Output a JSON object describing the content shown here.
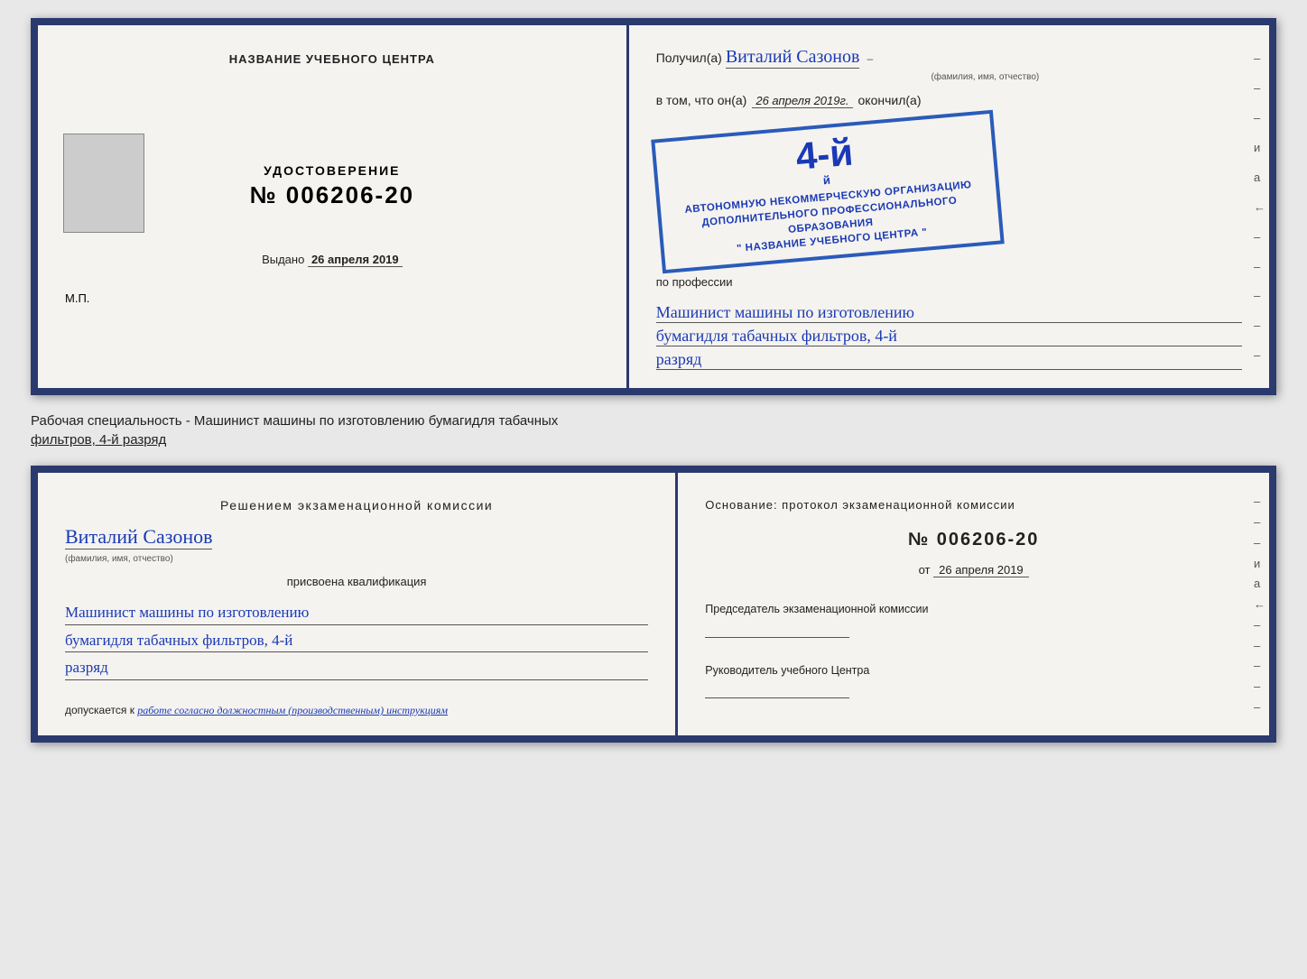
{
  "top_document": {
    "left": {
      "center_title": "НАЗВАНИЕ УЧЕБНОГО ЦЕНТРА",
      "photo_alt": "photo",
      "udostoverenie_title": "УДОСТОВЕРЕНИЕ",
      "udostoverenie_number": "№ 006206-20",
      "vydano_label": "Выдано",
      "vydano_date": "26 апреля 2019",
      "mp_label": "М.П."
    },
    "right": {
      "poluchil_prefix": "Получил(а)",
      "recipient_name": "Виталий Сазонов",
      "fio_label": "(фамилия, имя, отчество)",
      "vtom_prefix": "в том, что он(а)",
      "date": "26 апреля 2019г.",
      "okonchil": "окончил(а)",
      "stamp_number": "4-й",
      "stamp_line1": "АВТОНОМНУЮ НЕКОММЕРЧЕСКУЮ ОРГАНИЗАЦИЮ",
      "stamp_line2": "ДОПОЛНИТЕЛЬНОГО ПРОФЕССИОНАЛЬНОГО ОБРАЗОВАНИЯ",
      "stamp_line3": "\" НАЗВАНИЕ УЧЕБНОГО ЦЕНТРА \"",
      "po_professii": "по профессии",
      "profession_line1": "Машинист машины по изготовлению",
      "profession_line2": "бумагидля табачных фильтров, 4-й",
      "profession_line3": "разряд"
    }
  },
  "specialty_label": {
    "text1": "Рабочая специальность - Машинист машины по изготовлению бумагидля табачных",
    "text2": "фильтров, 4-й разряд"
  },
  "bottom_document": {
    "left": {
      "komissia_title": "Решением экзаменационной комиссии",
      "name": "Виталий Сазонов",
      "fio_label": "(фамилия, имя, отчество)",
      "prisvoena": "присвоена квалификация",
      "qualification_line1": "Машинист машины по изготовлению",
      "qualification_line2": "бумагидля табачных фильтров, 4-й",
      "qualification_line3": "разряд",
      "dopuskaetsya": "допускается к",
      "dopusk_text": "работе согласно должностным (производственным) инструкциям"
    },
    "right": {
      "osnovanie": "Основание: протокол экзаменационной комиссии",
      "number": "№ 006206-20",
      "ot_label": "от",
      "ot_date": "26 апреля 2019",
      "predsedatel_label": "Председатель экзаменационной комиссии",
      "rukovoditel_label": "Руководитель учебного Центра"
    }
  },
  "dashes": [
    "-",
    "-",
    "-",
    "и",
    "а",
    "←",
    "-",
    "-",
    "-",
    "-",
    "-"
  ]
}
